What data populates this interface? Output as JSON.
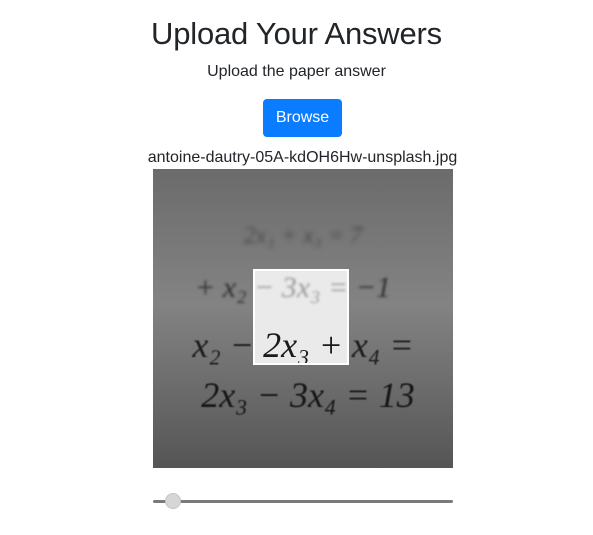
{
  "header": {
    "title": "Upload Your Answers",
    "subtitle": "Upload the paper answer"
  },
  "upload": {
    "browse_label": "Browse",
    "file_name": "antoine-dautry-05A-kdOH6Hw-unsplash.jpg"
  },
  "image": {
    "equation_lines": [
      "2x₁ + x₃ = 7",
      "+ x₂ − 3x₃ = −1",
      "x₂ − 2x₃ + x₄ =",
      "2x₃ − 3x₄ = 13"
    ]
  },
  "zoom": {
    "value_fraction": 0.04
  },
  "colors": {
    "accent": "#0a7cff",
    "photo_background": "#5a5a5a",
    "crop_border": "#ffffff"
  }
}
